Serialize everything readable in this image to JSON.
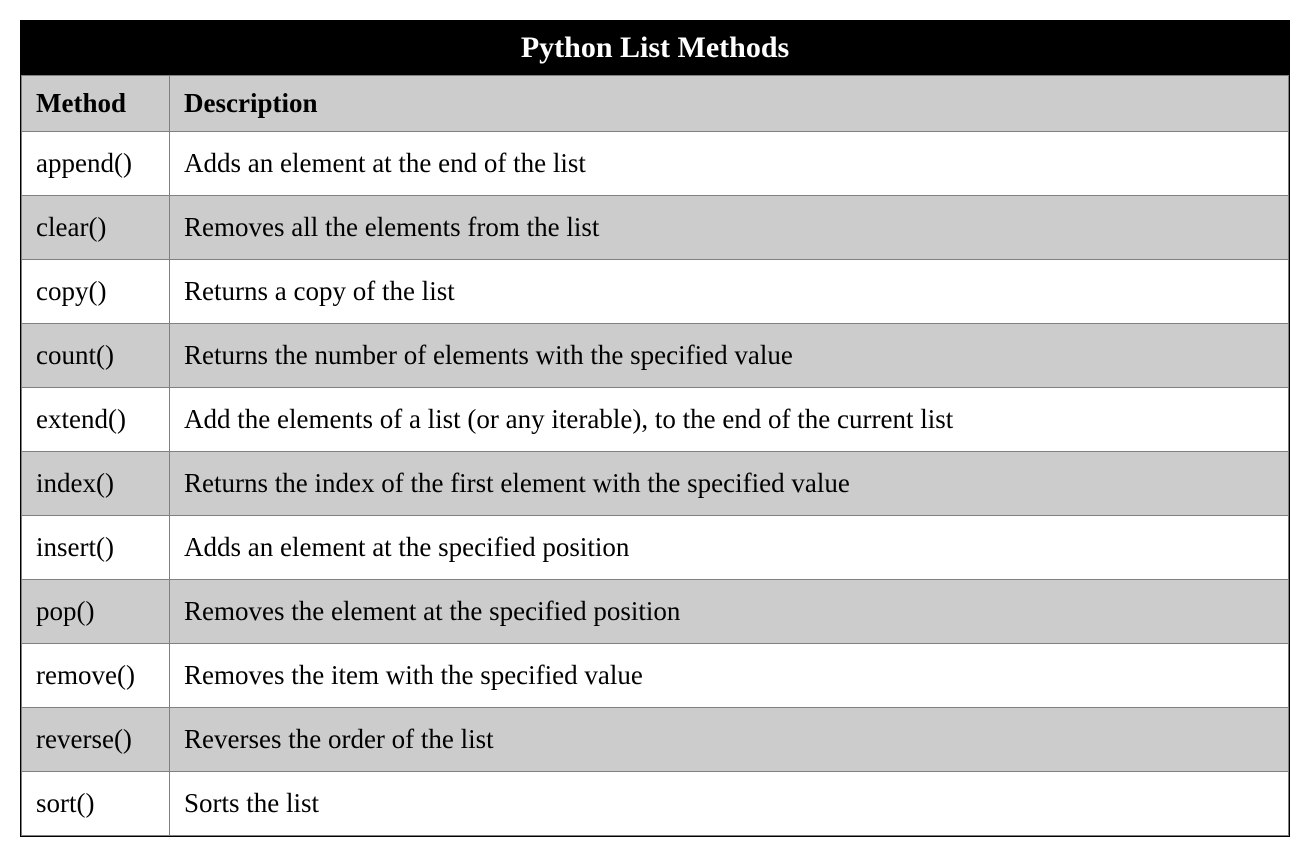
{
  "title": "Python List Methods",
  "headers": {
    "method": "Method",
    "description": "Description"
  },
  "rows": [
    {
      "method": "append()",
      "description": "Adds an element at the end of the list"
    },
    {
      "method": "clear()",
      "description": "Removes all the elements from the list"
    },
    {
      "method": "copy()",
      "description": "Returns a copy of the list"
    },
    {
      "method": "count()",
      "description": "Returns the number of elements with the specified value"
    },
    {
      "method": "extend()",
      "description": "Add the elements of a list (or any iterable), to the end of the current list"
    },
    {
      "method": "index()",
      "description": "Returns the index of the first element with the specified value"
    },
    {
      "method": "insert()",
      "description": "Adds an element at the specified position"
    },
    {
      "method": "pop()",
      "description": "Removes the element at the specified position"
    },
    {
      "method": "remove()",
      "description": "Removes the item with the specified value"
    },
    {
      "method": "reverse()",
      "description": "Reverses the order of the list"
    },
    {
      "method": "sort()",
      "description": "Sorts the list"
    }
  ]
}
